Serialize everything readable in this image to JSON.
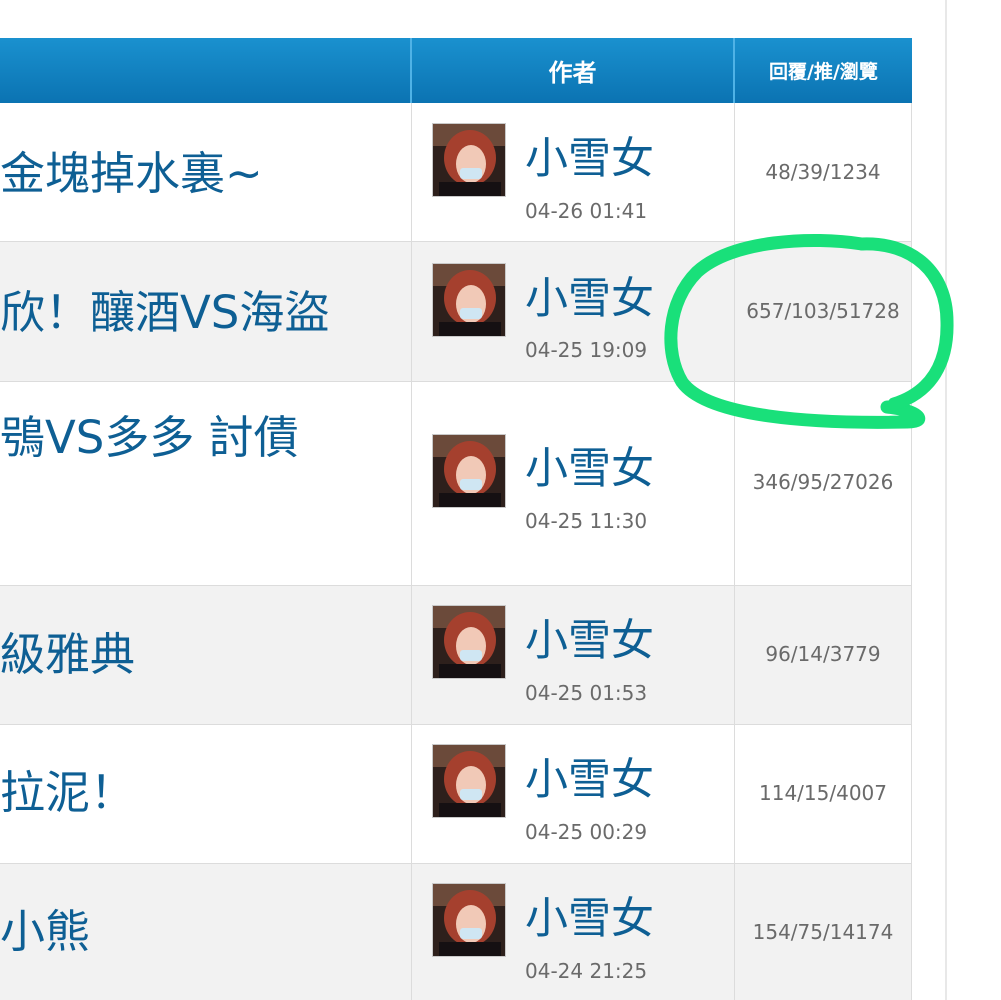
{
  "table": {
    "headers": {
      "title": "",
      "author": "作者",
      "stats": "回覆/推/瀏覽"
    },
    "rows": [
      {
        "title": "金塊掉水裏~",
        "author": "小雪女",
        "time": "04-26 01:41",
        "stats": "48/39/1234",
        "avatar": "author-avatar"
      },
      {
        "title": "欣！釀酒VS海盜",
        "author": "小雪女",
        "time": "04-25 19:09",
        "stats": "657/103/51728",
        "avatar": "author-avatar"
      },
      {
        "title": "鴞VS多多 討債",
        "author": "小雪女",
        "time": "04-25 11:30",
        "stats": "346/95/27026",
        "avatar": "author-avatar"
      },
      {
        "title": "級雅典",
        "author": "小雪女",
        "time": "04-25 01:53",
        "stats": "96/14/3779",
        "avatar": "author-avatar"
      },
      {
        "title": "拉泥！",
        "author": "小雪女",
        "time": "04-25 00:29",
        "stats": "114/15/4007",
        "avatar": "author-avatar"
      },
      {
        "title": "小熊",
        "author": "小雪女",
        "time": "04-24 21:25",
        "stats": "154/75/14174",
        "avatar": "author-avatar"
      }
    ]
  },
  "annotation": {
    "shape": "hand-drawn-circle",
    "color": "#19e07a",
    "highlighted_row": 1
  },
  "colors": {
    "header_bg": "#0b73b2",
    "title_link": "#0e5f94",
    "meta_text": "#6a6a6a",
    "stripe_bg": "#f2f2f2"
  }
}
